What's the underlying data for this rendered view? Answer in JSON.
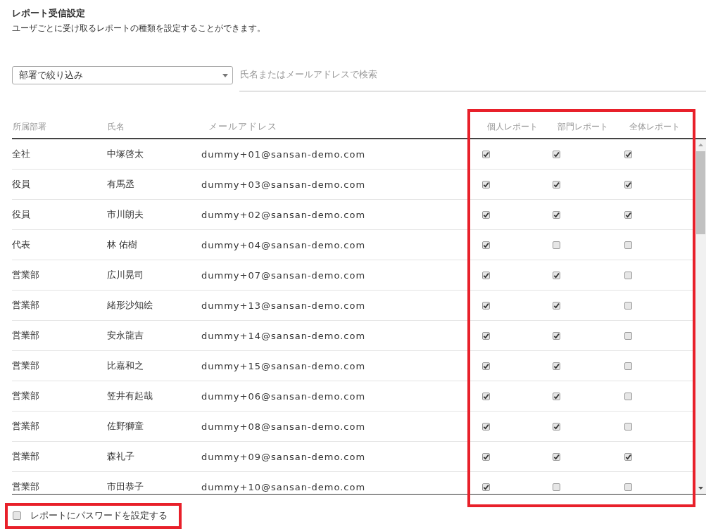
{
  "title": "レポート受信設定",
  "description": "ユーザごとに受け取るレポートの種類を設定することができます。",
  "department_filter": {
    "value": "部署で絞り込み"
  },
  "search": {
    "placeholder": "氏名またはメールアドレスで検索"
  },
  "table": {
    "columns": [
      "所属部署",
      "氏名",
      "メールアドレス",
      "個人レポート",
      "部門レポート",
      "全体レポート"
    ],
    "rows": [
      {
        "department": "全社",
        "name": "中塚啓太",
        "email": "dummy+01@sansan-demo.com",
        "reports": [
          {
            "checked": true
          },
          {
            "checked": true
          },
          {
            "checked": true
          }
        ]
      },
      {
        "department": "役員",
        "name": "有馬丞",
        "email": "dummy+03@sansan-demo.com",
        "reports": [
          {
            "checked": true
          },
          {
            "checked": true
          },
          {
            "checked": true
          }
        ]
      },
      {
        "department": "役員",
        "name": "市川朗夫",
        "email": "dummy+02@sansan-demo.com",
        "reports": [
          {
            "checked": true
          },
          {
            "checked": true
          },
          {
            "checked": true
          }
        ]
      },
      {
        "department": "代表",
        "name": "林 佑樹",
        "email": "dummy+04@sansan-demo.com",
        "reports": [
          {
            "checked": true
          },
          {
            "checked": false
          },
          {
            "checked": false
          }
        ]
      },
      {
        "department": "営業部",
        "name": "広川晃司",
        "email": "dummy+07@sansan-demo.com",
        "reports": [
          {
            "checked": true
          },
          {
            "checked": true
          },
          {
            "checked": false
          }
        ]
      },
      {
        "department": "営業部",
        "name": "緒形沙知絵",
        "email": "dummy+13@sansan-demo.com",
        "reports": [
          {
            "checked": true
          },
          {
            "checked": true
          },
          {
            "checked": false
          }
        ]
      },
      {
        "department": "営業部",
        "name": "安永龍吉",
        "email": "dummy+14@sansan-demo.com",
        "reports": [
          {
            "checked": true
          },
          {
            "checked": true
          },
          {
            "checked": false
          }
        ]
      },
      {
        "department": "営業部",
        "name": "比嘉和之",
        "email": "dummy+15@sansan-demo.com",
        "reports": [
          {
            "checked": true
          },
          {
            "checked": true
          },
          {
            "checked": false
          }
        ]
      },
      {
        "department": "営業部",
        "name": "笠井有起哉",
        "email": "dummy+06@sansan-demo.com",
        "reports": [
          {
            "checked": true
          },
          {
            "checked": true
          },
          {
            "checked": false
          }
        ]
      },
      {
        "department": "営業部",
        "name": "佐野獅童",
        "email": "dummy+08@sansan-demo.com",
        "reports": [
          {
            "checked": true
          },
          {
            "checked": true
          },
          {
            "checked": false
          }
        ]
      },
      {
        "department": "営業部",
        "name": "森礼子",
        "email": "dummy+09@sansan-demo.com",
        "reports": [
          {
            "checked": true
          },
          {
            "checked": true
          },
          {
            "checked": true
          }
        ]
      },
      {
        "department": "営業部",
        "name": "市田恭子",
        "email": "dummy+10@sansan-demo.com",
        "reports": [
          {
            "checked": true
          },
          {
            "checked": false
          },
          {
            "checked": false
          }
        ]
      }
    ]
  },
  "password_option": {
    "label": "レポートにパスワードを設定する",
    "checked": false
  }
}
